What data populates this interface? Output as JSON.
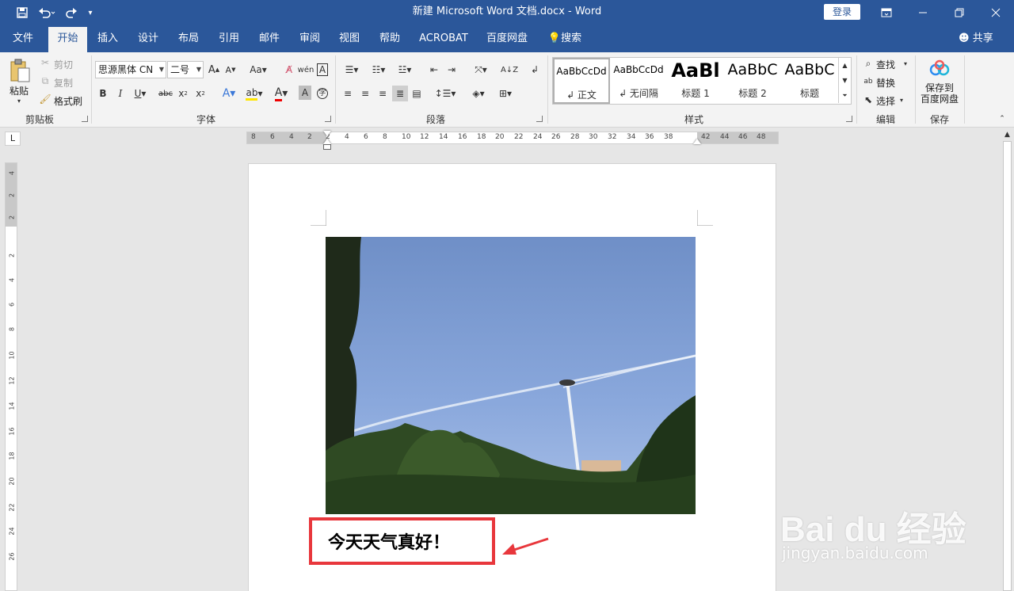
{
  "title_bar": {
    "doc_title": "新建 Microsoft Word 文档.docx  -  Word",
    "login": "登录"
  },
  "tabs": [
    "文件",
    "开始",
    "插入",
    "设计",
    "布局",
    "引用",
    "邮件",
    "审阅",
    "视图",
    "帮助",
    "ACROBAT",
    "百度网盘"
  ],
  "tell_me": "搜索",
  "share": "共享",
  "clipboard": {
    "paste": "粘贴",
    "cut": "剪切",
    "copy": "复制",
    "format_painter": "格式刷",
    "label": "剪贴板"
  },
  "font": {
    "name": "思源黑体 CN",
    "size": "二号",
    "label": "字体"
  },
  "paragraph": {
    "label": "段落"
  },
  "styles": {
    "items": [
      {
        "preview": "AaBbCcDd",
        "name": "↲ 正文"
      },
      {
        "preview": "AaBbCcDd",
        "name": "↲ 无间隔"
      },
      {
        "preview": "AaBl",
        "name": "标题 1"
      },
      {
        "preview": "AaBbC",
        "name": "标题 2"
      },
      {
        "preview": "AaBbC",
        "name": "标题"
      }
    ],
    "label": "样式"
  },
  "editing": {
    "find": "查找",
    "replace": "替换",
    "select": "选择",
    "label": "编辑"
  },
  "save_group": {
    "button": "保存到\n百度网盘",
    "label": "保存"
  },
  "ruler": {
    "h_numbers": [
      "8",
      "6",
      "4",
      "2",
      "2",
      "4",
      "6",
      "8",
      "10",
      "12",
      "14",
      "16",
      "18",
      "20",
      "22",
      "24",
      "26",
      "28",
      "30",
      "32",
      "34",
      "36",
      "38",
      "42",
      "44",
      "46",
      "48"
    ],
    "v_numbers": [
      "4",
      "2",
      "2",
      "2",
      "4",
      "6",
      "8",
      "10",
      "12",
      "14",
      "16",
      "18",
      "20",
      "22",
      "24",
      "26"
    ],
    "corner": "L"
  },
  "document": {
    "text": "今天天气真好！"
  },
  "watermark": {
    "brand": "Bai du 经验",
    "url": "jingyan.baidu.com"
  },
  "colors": {
    "accent": "#2b579a",
    "highlight_box": "#e8373c",
    "arrow": "#e8373c"
  }
}
